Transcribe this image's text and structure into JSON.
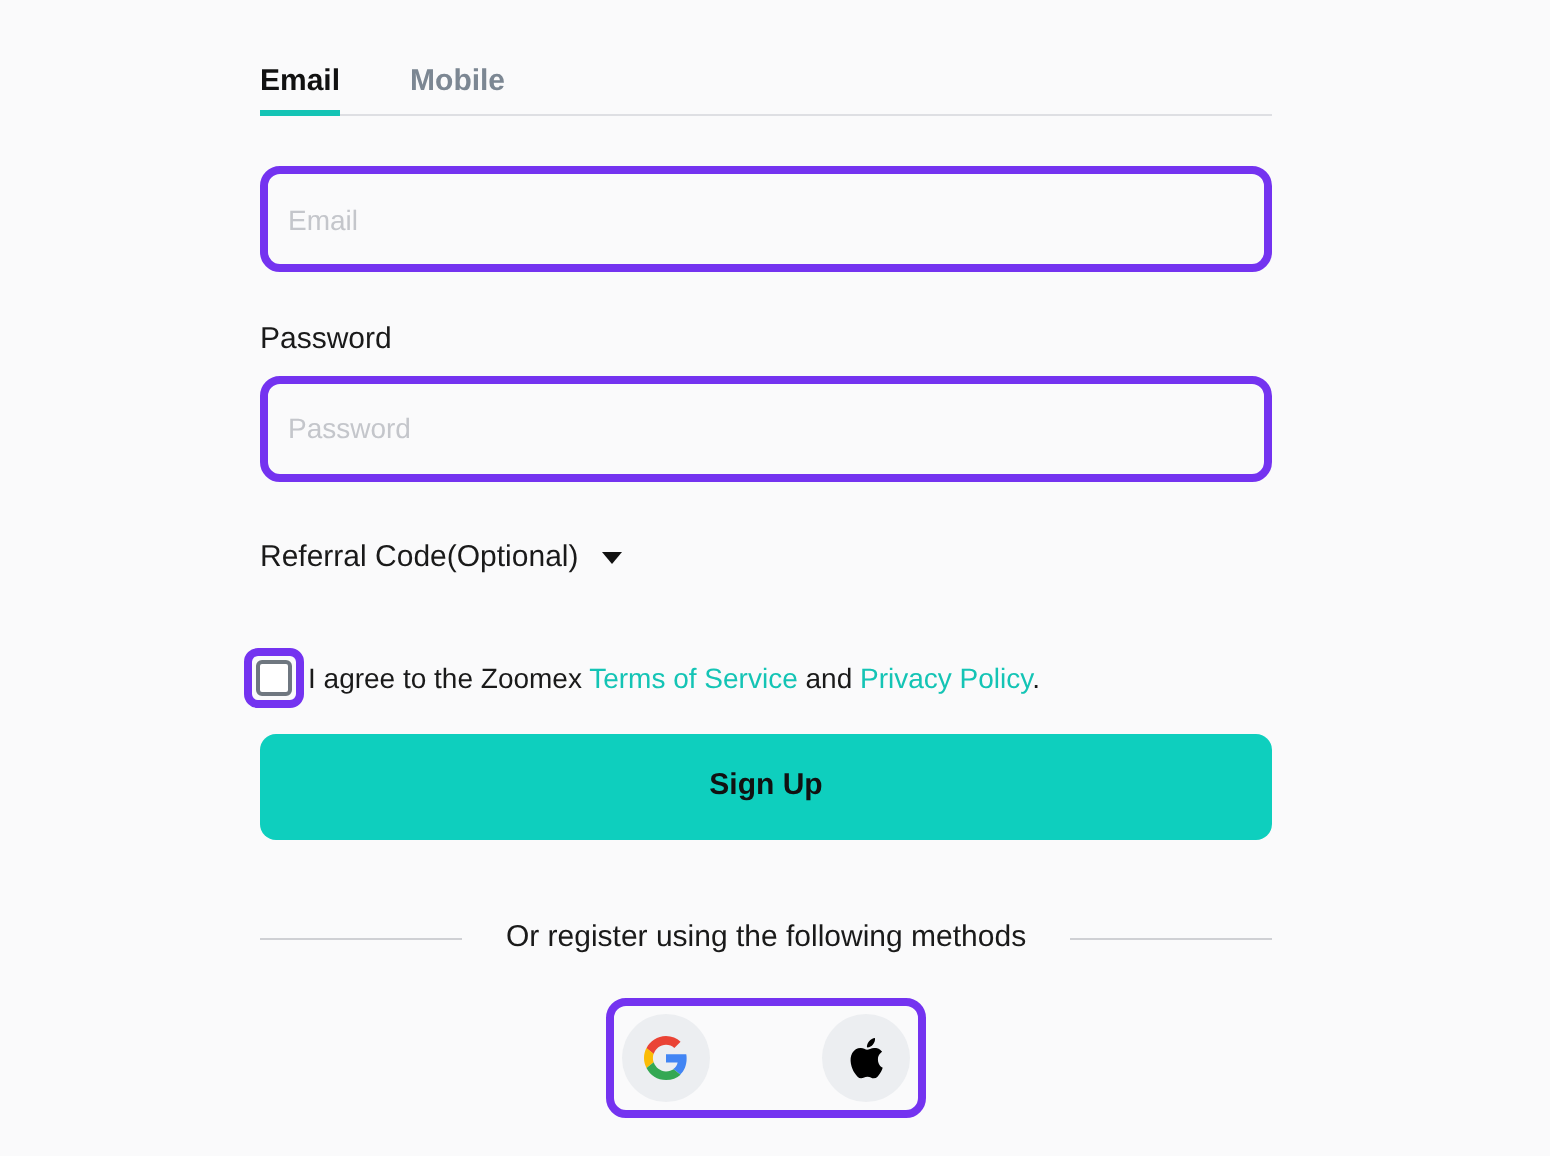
{
  "tabs": [
    {
      "label": "Email",
      "selected": true
    },
    {
      "label": "Mobile",
      "selected": false
    }
  ],
  "email_field": {
    "placeholder": "Email",
    "highlighted": true
  },
  "password": {
    "label": "Password",
    "placeholder": "Password",
    "highlighted": true
  },
  "referral": {
    "label": "Referral Code(Optional)",
    "expanded": false
  },
  "agreement": {
    "checked": false,
    "highlighted": true,
    "text_before": "I agree to the Zoomex",
    "terms_link": "Terms of Service",
    "text_middle": "and",
    "privacy_link": "Privacy Policy",
    "text_after": "."
  },
  "sign_up_button": "Sign Up",
  "divider_text": "Or register using the following methods",
  "social": {
    "highlighted": true,
    "providers": [
      {
        "kind": "google"
      },
      {
        "kind": "apple"
      }
    ]
  }
}
